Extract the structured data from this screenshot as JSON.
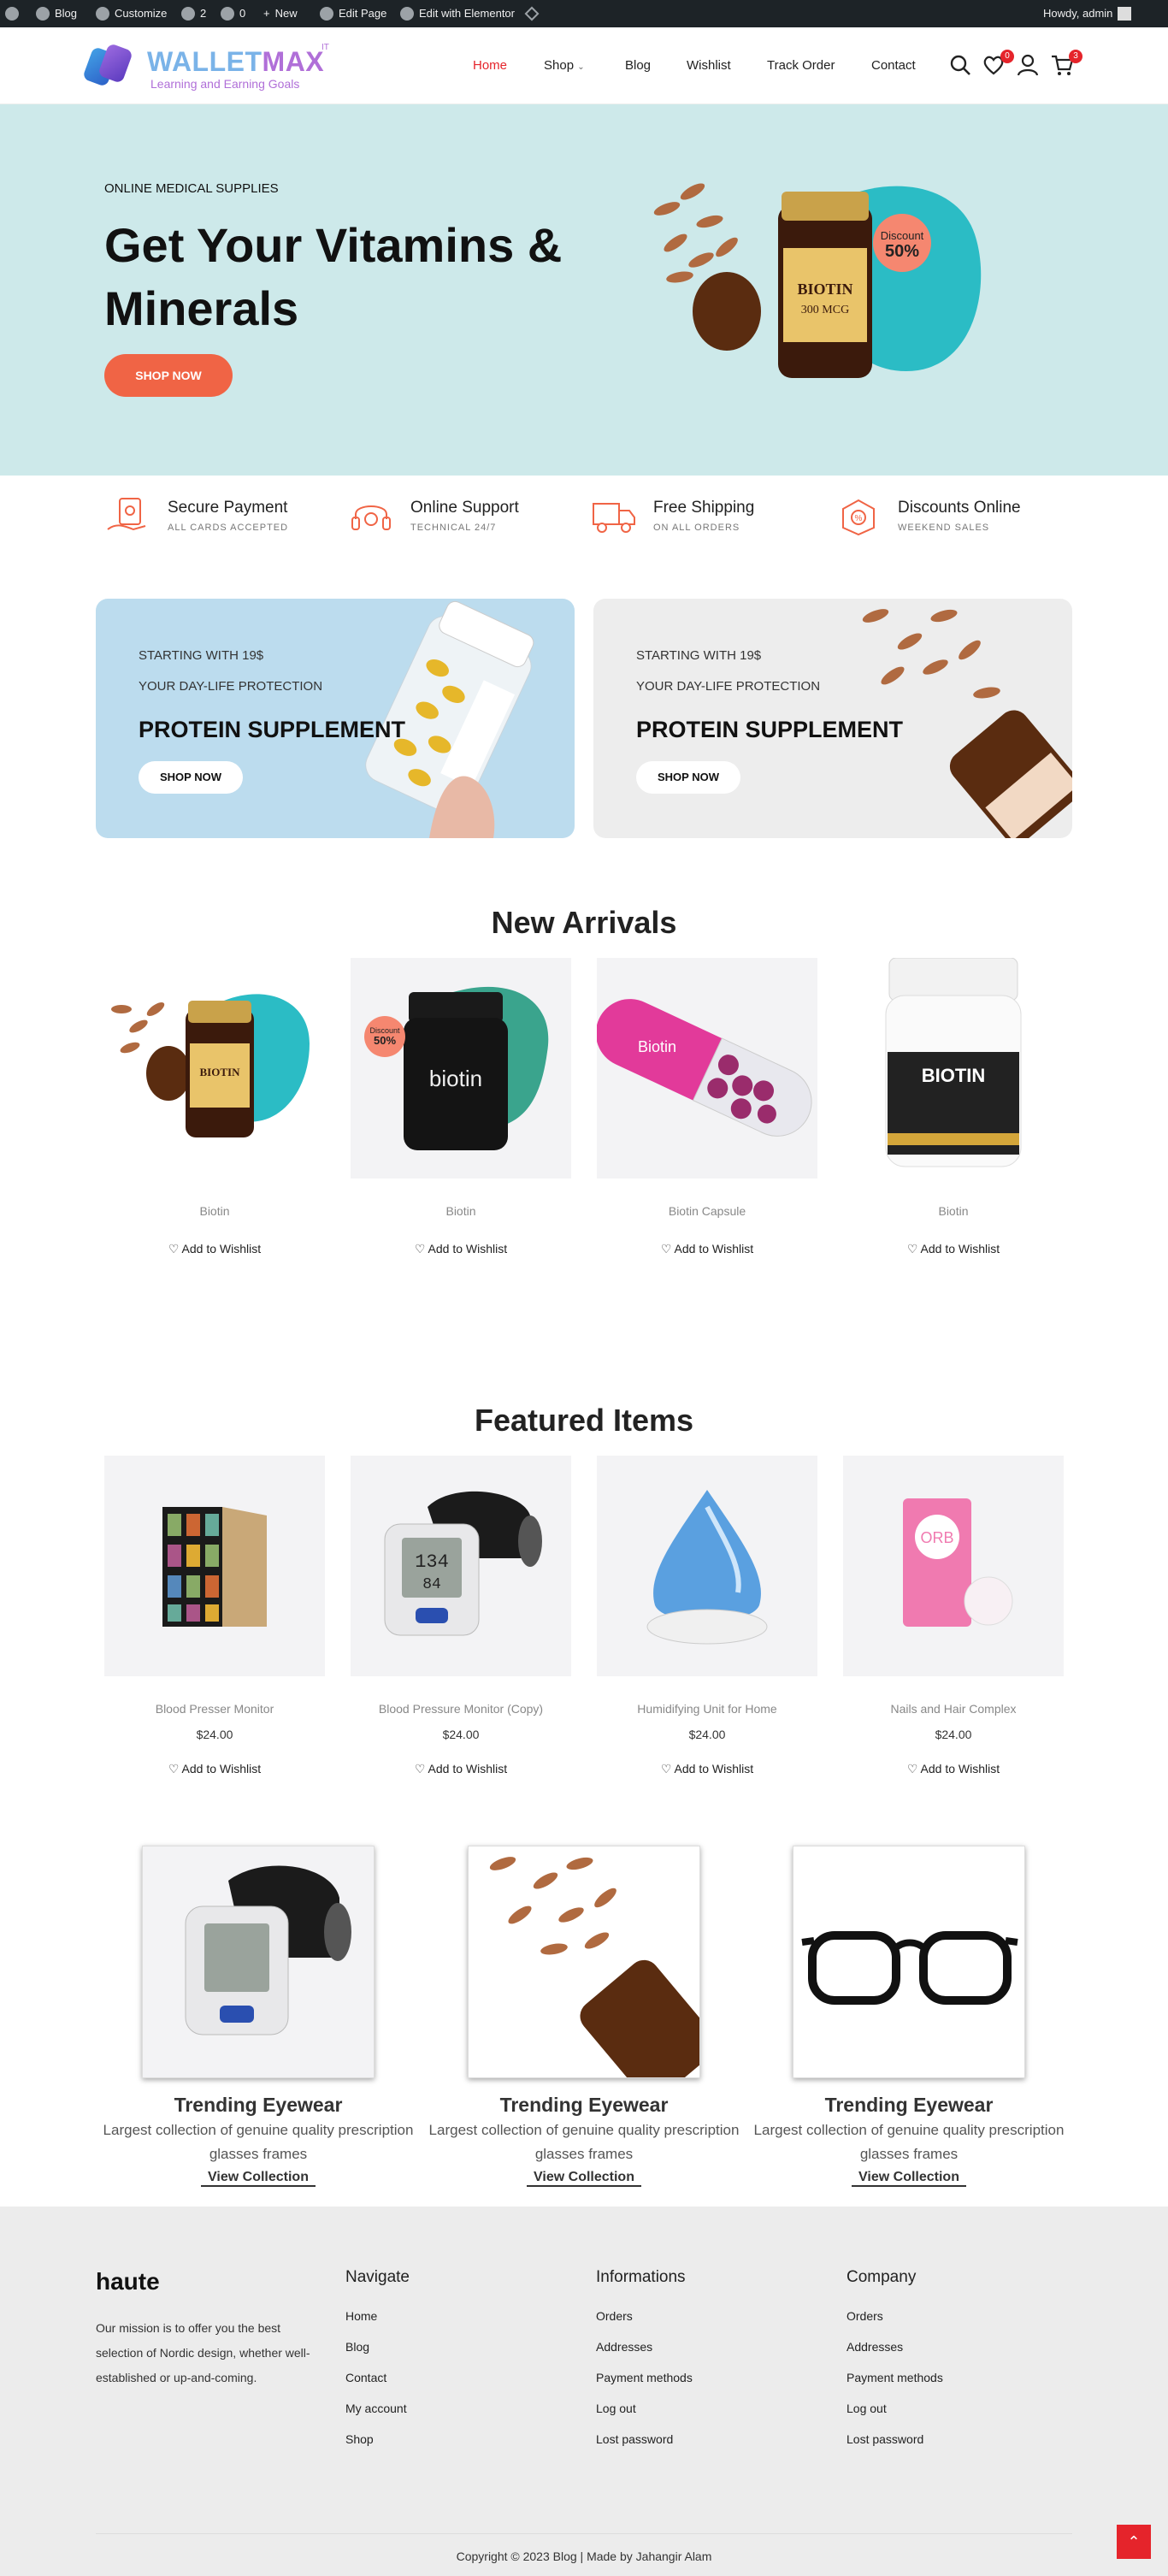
{
  "adminbar": {
    "blog": "Blog",
    "customize": "Customize",
    "updates": "2",
    "comments": "0",
    "new": "New",
    "edit_page": "Edit Page",
    "elementor": "Edit with Elementor",
    "howdy": "Howdy, admin"
  },
  "header": {
    "logo_main_a": "WALLET",
    "logo_main_b": "MAX",
    "logo_sup": "IT",
    "logo_sub": "Learning and Earning Goals",
    "nav": [
      "Home",
      "Shop",
      "Blog",
      "Wishlist",
      "Track Order",
      "Contact"
    ],
    "wishlist_count": "0",
    "cart_count": "3",
    "colors": {
      "active_nav": "#e5242b",
      "accent": "#f06445"
    }
  },
  "hero": {
    "kicker": "ONLINE MEDICAL SUPPLIES",
    "title": "Get Your Vitamins & Minerals",
    "cta": "SHOP NOW",
    "discount_label": "Discount",
    "discount_value": "50%",
    "product_label": "BIOTIN 300 MCG"
  },
  "features": [
    {
      "title": "Secure Payment",
      "sub": "ALL CARDS ACCEPTED",
      "icon": "secure-payment-icon"
    },
    {
      "title": "Online Support",
      "sub": "TECHNICAL 24/7",
      "icon": "headset-icon"
    },
    {
      "title": "Free Shipping",
      "sub": "ON ALL ORDERS",
      "icon": "truck-icon"
    },
    {
      "title": "Discounts Online",
      "sub": "WEEKEND SALES",
      "icon": "discount-box-icon"
    }
  ],
  "banners": [
    {
      "line1": "STARTING WITH 19$",
      "line2": "YOUR DAY-LIFE PROTECTION",
      "title": "PROTEIN SUPPLEMENT",
      "cta": "SHOP NOW"
    },
    {
      "line1": "STARTING WITH 19$",
      "line2": "YOUR DAY-LIFE PROTECTION",
      "title": "PROTEIN SUPPLEMENT",
      "cta": "SHOP NOW"
    }
  ],
  "new_arrivals": {
    "title": "New Arrivals",
    "items": [
      {
        "name": "Biotin",
        "wishlist": "Add to Wishlist"
      },
      {
        "name": "Biotin",
        "wishlist": "Add to Wishlist",
        "discount_label": "Discount",
        "discount_value": "50%",
        "label": "biotin"
      },
      {
        "name": "Biotin Capsule",
        "wishlist": "Add to Wishlist",
        "label": "Biotin"
      },
      {
        "name": "Biotin",
        "wishlist": "Add to Wishlist",
        "label": "BIOTIN"
      }
    ]
  },
  "featured": {
    "title": "Featured Items",
    "items": [
      {
        "name": "Blood Presser Monitor",
        "price": "$24.00",
        "wishlist": "Add to Wishlist"
      },
      {
        "name": "Blood Pressure Monitor (Copy)",
        "price": "$24.00",
        "wishlist": "Add to Wishlist"
      },
      {
        "name": "Humidifying Unit for Home",
        "price": "$24.00",
        "wishlist": "Add to Wishlist"
      },
      {
        "name": "Nails and Hair Complex",
        "price": "$24.00",
        "wishlist": "Add to Wishlist",
        "label": "ORB"
      }
    ]
  },
  "trending": [
    {
      "title": "Trending Eyewear",
      "desc": "Largest collection of genuine quality prescription glasses frames",
      "link": "View Collection"
    },
    {
      "title": "Trending Eyewear",
      "desc": "Largest collection of genuine quality prescription glasses frames",
      "link": "View Collection"
    },
    {
      "title": "Trending Eyewear",
      "desc": "Largest collection of genuine quality prescription glasses frames",
      "link": "View Collection"
    }
  ],
  "footer": {
    "brand": "haute",
    "mission": "Our mission is to offer you the best selection of Nordic design, whether well-established or up-and-coming.",
    "cols": [
      {
        "title": "Navigate",
        "links": [
          "Home",
          "Blog",
          "Contact",
          "My account",
          "Shop"
        ]
      },
      {
        "title": "Informations",
        "links": [
          "Orders",
          "Addresses",
          "Payment methods",
          "Log out",
          "Lost password"
        ]
      },
      {
        "title": "Company",
        "links": [
          "Orders",
          "Addresses",
          "Payment methods",
          "Log out",
          "Lost password"
        ]
      }
    ],
    "copyright": "Copyright © 2023 Blog | Made by Jahangir Alam"
  }
}
